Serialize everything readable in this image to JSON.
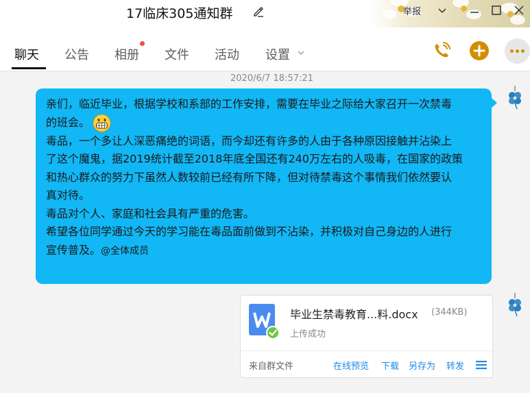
{
  "window": {
    "title": "17临床305通知群",
    "report_label": "举报"
  },
  "tabs": [
    {
      "label": "聊天"
    },
    {
      "label": "公告"
    },
    {
      "label": "相册"
    },
    {
      "label": "文件"
    },
    {
      "label": "活动"
    },
    {
      "label": "设置"
    }
  ],
  "toolbar_icons": [
    "phone-call-icon",
    "add-icon",
    "more-icon"
  ],
  "chat": {
    "timestamp": "2020/6/7 18:57:21",
    "message": {
      "lines": [
        "亲们，临近毕业，根据学校和系部的工作安排，需要在毕业之际给大家召开一次禁毒",
        "的班会。",
        "毒品，一个多让人深恶痛绝的词语，而今却还有许多的人由于各种原因接触并沾染上",
        "了这个魔鬼，据2019统计截至2018年底全国还有240万左右的人吸毒，在国家的政策",
        "和热心群众的努力下虽然人数较前已经有所下降，但对待禁毒这个事情我们依然要认",
        "真对待。",
        "毒品对个人、家庭和社会具有严重的危害。",
        "希望各位同学通过今天的学习能在毒品面前做到不沾染，并积极对自己身边的人进行",
        "宣传普及。"
      ],
      "mention": "@全体成员",
      "emoji": "grinning-face-icon"
    },
    "file": {
      "name": "毕业生禁毒教育...料.docx",
      "size": "(344KB)",
      "status": "上传成功",
      "source": "来自群文件",
      "actions": [
        "在线预览",
        "下载",
        "另存为",
        "转发"
      ]
    }
  },
  "colors": {
    "bubble": "#12b7f5",
    "accent": "#d18e00",
    "link": "#1e8ae6",
    "file_icon": "#4a8bf0",
    "success": "#6cc644"
  }
}
